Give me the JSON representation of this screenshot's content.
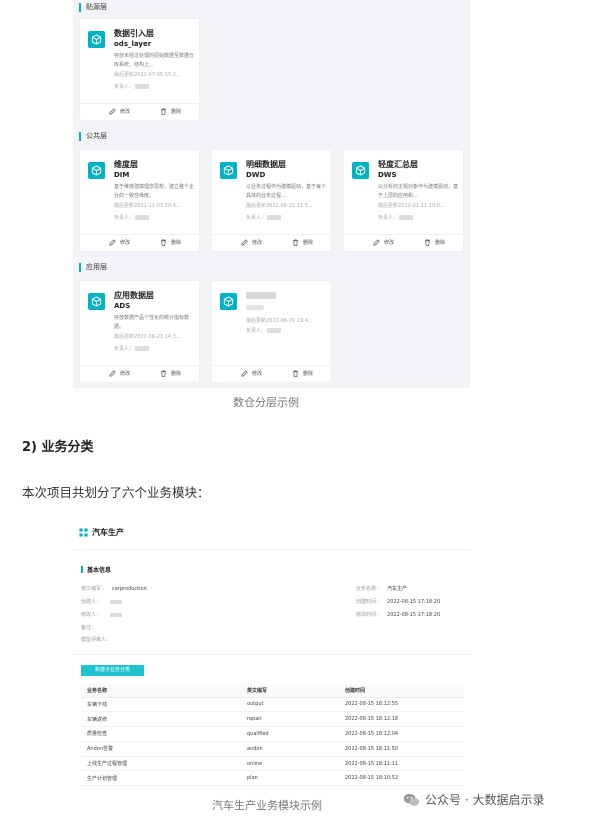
{
  "layers": {
    "sections": [
      {
        "title": "贴源层",
        "cards": [
          {
            "name": "数据引入层",
            "code": "ods_layer",
            "desc": "存放未经过处理的原始数据至数据仓库系统，结构上...",
            "updated": "最后更新2022-07-05 15:2...",
            "owner_label": "负责人："
          }
        ]
      },
      {
        "title": "公共层",
        "cards": [
          {
            "name": "维度层",
            "code": "DIM",
            "desc": "基于维度建模理念思想，建立整个企业的一致性维度。",
            "updated": "最后更新2021-11-03 20:4...",
            "owner_label": "负责人："
          },
          {
            "name": "明细数据层",
            "code": "DWD",
            "desc": "以业务过程作为建模驱动，基于每个具体的业务过程...",
            "updated": "最后更新2022-06-22 11:5...",
            "owner_label": "负责人："
          },
          {
            "name": "轻度汇总层",
            "code": "DWS",
            "desc": "以分析的主题对象作为建模驱动，基于上层的应用和...",
            "updated": "最后更新2022-01-11 10:0...",
            "owner_label": "负责人："
          }
        ]
      },
      {
        "title": "应用层",
        "cards": [
          {
            "name": "应用数据层",
            "code": "ADS",
            "desc": "存放数据产品个性化的统计指标数据。",
            "updated": "最后更新2021-08-23 14:3...",
            "owner_label": "负责人："
          },
          {
            "name": "",
            "code": "",
            "desc": "",
            "updated": "最后更新2022-06-09 19:4...",
            "owner_label": "负责人："
          }
        ]
      }
    ],
    "edit_label": "修改",
    "delete_label": "删除"
  },
  "caption1": "数仓分层示例",
  "heading": "2)   业务分类",
  "paragraph": "本次项目共划分了六个业务模块：",
  "module": {
    "title": "汽车生产",
    "basic_info": "基本信息",
    "fields_left": [
      {
        "label": "英文缩写：",
        "value": "carproduction"
      },
      {
        "label": "创建人：",
        "value": ""
      },
      {
        "label": "修改人：",
        "value": ""
      },
      {
        "label": "备注：",
        "value": ""
      },
      {
        "label": "模型评审人：",
        "value": ""
      }
    ],
    "fields_right": [
      {
        "label": "业务名称：",
        "value": "汽车生产"
      },
      {
        "label": "创建时间：",
        "value": "2022-08-15 17:18:20"
      },
      {
        "label": "修改时间：",
        "value": "2022-08-15 17:18:20"
      }
    ],
    "add_button": "新建子业务分类",
    "table": {
      "headers": [
        "业务名称",
        "英文缩写",
        "创建时间"
      ],
      "rows": [
        [
          "车辆下线",
          "output",
          "2022-08-15 18:12:55"
        ],
        [
          "车辆返修",
          "repair",
          "2022-08-15 18:12:18"
        ],
        [
          "质量检查",
          "qualified",
          "2022-08-15 18:12:04"
        ],
        [
          "Andon告警",
          "andon",
          "2022-08-15 18:11:50"
        ],
        [
          "上线生产过程管理",
          "online",
          "2022-08-15 18:11:11"
        ],
        [
          "生产计划管理",
          "plan",
          "2022-08-15 18:10:52"
        ]
      ]
    }
  },
  "caption2": "汽车生产业务模块示例",
  "watermark": "公众号 · 大数据启示录",
  "colors": {
    "accent": "#00b2c2",
    "button": "#1fc3cf",
    "panel_bg": "#f3f4f8"
  }
}
